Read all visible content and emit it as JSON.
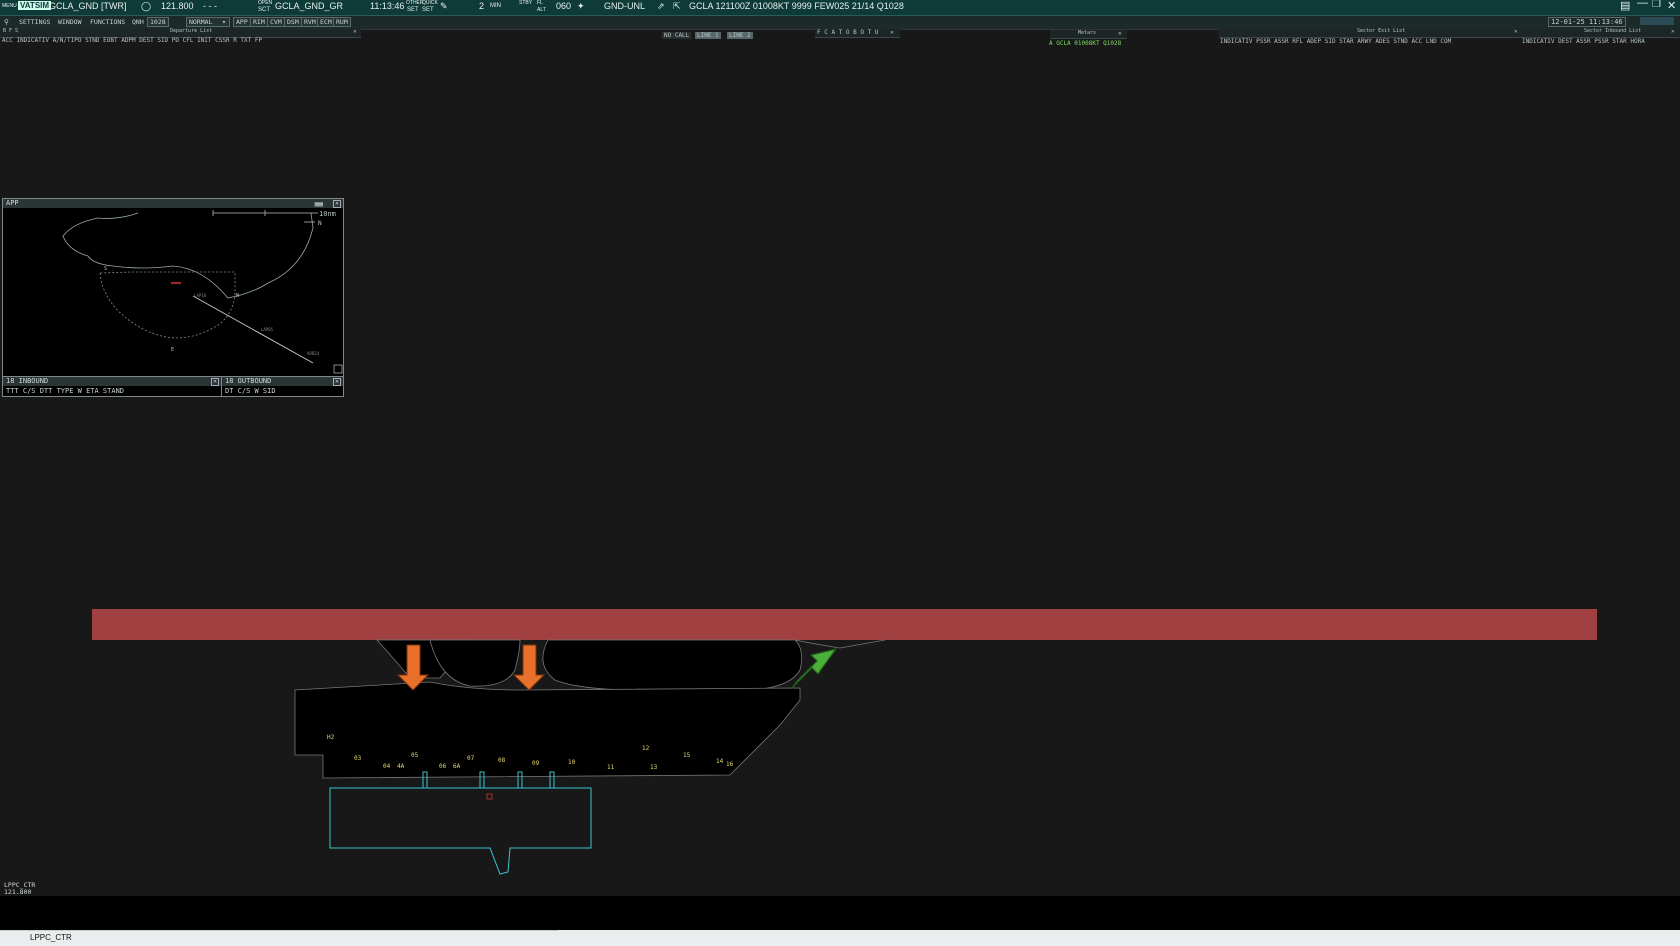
{
  "topbar": {
    "menu_label": "MENU",
    "app_logo": "VATSIM",
    "profile": "GCLA_GND [TWR]",
    "frequency": "121.800",
    "freq_dashes": "-   -   -",
    "open_label": "OPEN",
    "sct_label": "SCT",
    "position": "GCLA_GND_GR",
    "time": "11:13:46",
    "other_label": "OTHER",
    "quick_label": "QUICK",
    "set1": "SET",
    "set2": "SET",
    "min_value": "2",
    "min_label": "MIN",
    "stby_label": "STBY",
    "fl_label": "FL",
    "alt_label": "ALT",
    "heading": "060",
    "level": "GND-UNL",
    "metar": "GCLA 121100Z 01008KT 9999 FEW025 21/14 Q1028"
  },
  "menubar": {
    "settings": "SETTINGS",
    "window": "WINDOW",
    "functions": "FUNCTIONS",
    "qnh_label": "QNH",
    "qnh_value": "1028",
    "mode": "NORMAL",
    "filters": [
      "APP",
      "RIM",
      "CVM",
      "DSM",
      "RVM",
      "ECM",
      "RUM"
    ],
    "datetime": "12-01-25 11:13:46"
  },
  "departure_list": {
    "title": "Departure List",
    "columns": "ACC INDICATIV A/N/TIPO STND EOBT ADPM DEST   SID    PD   CFL  INIT CSSR R      TXT     FP"
  },
  "center_buttons": {
    "nocall": "NO CALL",
    "line1": "LINE 1",
    "line2": "LINE 2"
  },
  "metars_panel": {
    "title": "Metars",
    "entry": "A GCLA 01008KT Q1028"
  },
  "sector_exit": {
    "title": "Sector Exit List",
    "columns": "INDICATIV PSSR ASSR  RFL  ADEP    SID      STAR   ARWY ADES  STND   ACC  LND COM"
  },
  "sector_inbound": {
    "title": "Sector Inbound List",
    "columns": "INDICATIV  DEST   ASSR  PSSR   STAR  HORA"
  },
  "app_window": {
    "title": "APP",
    "scale": "10nm",
    "north": "N",
    "label_s": "S",
    "label_n": "N",
    "label_e": "E",
    "fix1": "LAP10",
    "fix2": "LAP05",
    "fix3": "VOR24"
  },
  "inbound_window": {
    "title": "18 INBOUND",
    "columns": "TTT  C/S        DTT TYPE W ETA  STAND"
  },
  "outbound_window": {
    "title": "18 OUTBOUND",
    "columns": "DT   C/S           W SID"
  },
  "stands": {
    "h2": "H2",
    "s03": "03",
    "s04": "04",
    "s4a": "4A",
    "s05": "05",
    "s06": "06",
    "s6a": "6A",
    "s07": "07",
    "s08": "08",
    "s09": "09",
    "s10": "10",
    "s11": "11",
    "s12": "12",
    "s13": "13",
    "s15": "15",
    "s14": "14",
    "s16": "16"
  },
  "colors": {
    "runway": "#a04041",
    "arrival_arrow": "#e8702a",
    "departure_arrow": "#4caf3a",
    "terminal": "#3ec4cc",
    "topbar": "#0e3a37"
  },
  "status": {
    "ctr_name": "LPPC_CTR",
    "ctr_freq": "121.800"
  },
  "command_line": {
    "value": "LPPC_CTR"
  }
}
